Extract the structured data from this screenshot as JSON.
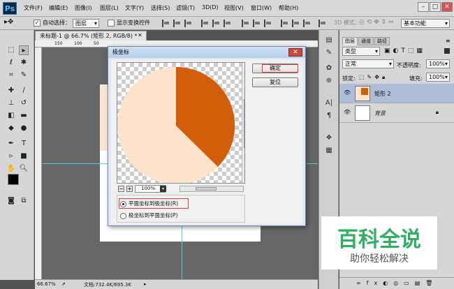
{
  "app": {
    "logo": "Ps"
  },
  "menubar": {
    "items": [
      "文件(F)",
      "编辑(E)",
      "图像(I)",
      "图层(L)",
      "文字(Y)",
      "选择(S)",
      "滤镜(T)",
      "3D(D)",
      "视图(V)",
      "窗口(W)",
      "帮助(H)"
    ]
  },
  "optionsbar": {
    "auto_select_label": "自动选择：",
    "auto_select_checked": true,
    "target_value": "图层",
    "show_transform_label": "显示变换控件",
    "show_transform_checked": false,
    "mode_3d_label": "3D 模式：",
    "workspace_value": "基本功能"
  },
  "document": {
    "tab_label": "未标题-1 @ 66.7% (矩形 2, RGB/8) *",
    "ruler_top_labels": [
      "150",
      "100",
      "50"
    ],
    "canvas_color": "#ffffff",
    "shape_color": "#fde6d2"
  },
  "statusbar": {
    "zoom": "66.67%",
    "doc_info": "文档:732.4K/695.3K"
  },
  "dialog": {
    "title": "极坐标",
    "close_label": "✕",
    "ok_label": "确定",
    "reset_label": "复位",
    "zoom_value": "100%",
    "zoom_minus": "−",
    "zoom_plus": "+",
    "options": [
      {
        "label": "平面坐标到极坐标(R)",
        "selected": true
      },
      {
        "label": "极坐标到平面坐标(P)",
        "selected": false
      }
    ],
    "preview_colors": {
      "light": "#fde3cc",
      "dark": "#d35e0a"
    }
  },
  "layers_panel": {
    "tabs": [
      "图层",
      "通道",
      "路径"
    ],
    "filter_value": "类型",
    "blend_mode": "正常",
    "opacity_label": "不透明度:",
    "opacity_value": "100%",
    "lock_label": "锁定:",
    "fill_label": "填充:",
    "fill_value": "100%",
    "layers": [
      {
        "name": "矩形 2",
        "selected": true,
        "locked": false
      },
      {
        "name": "背景",
        "selected": false,
        "locked": true
      }
    ]
  },
  "watermark": {
    "title": "百科全说",
    "subtitle": "助你轻松解决"
  }
}
